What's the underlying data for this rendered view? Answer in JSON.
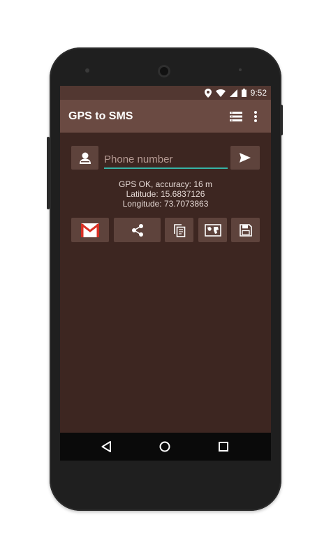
{
  "status_bar": {
    "time": "9:52"
  },
  "app_bar": {
    "title": "GPS to SMS"
  },
  "phone_field": {
    "placeholder": "Phone number",
    "value": ""
  },
  "location": {
    "status": "GPS OK, accuracy: 16 m",
    "latitude": "Latitude: 15.6837126",
    "longitude": "Longitude: 73.7073863"
  },
  "actions": [
    {
      "name": "gmail",
      "icon": "gmail-icon"
    },
    {
      "name": "share",
      "icon": "share-icon"
    },
    {
      "name": "copy",
      "icon": "copy-icon"
    },
    {
      "name": "map",
      "icon": "map-icon"
    },
    {
      "name": "save",
      "icon": "save-icon"
    }
  ],
  "colors": {
    "background": "#3d2621",
    "app_bar": "#6a4a42",
    "status_bar": "#523731",
    "button": "#5e433c",
    "accent": "#36b3a6"
  }
}
